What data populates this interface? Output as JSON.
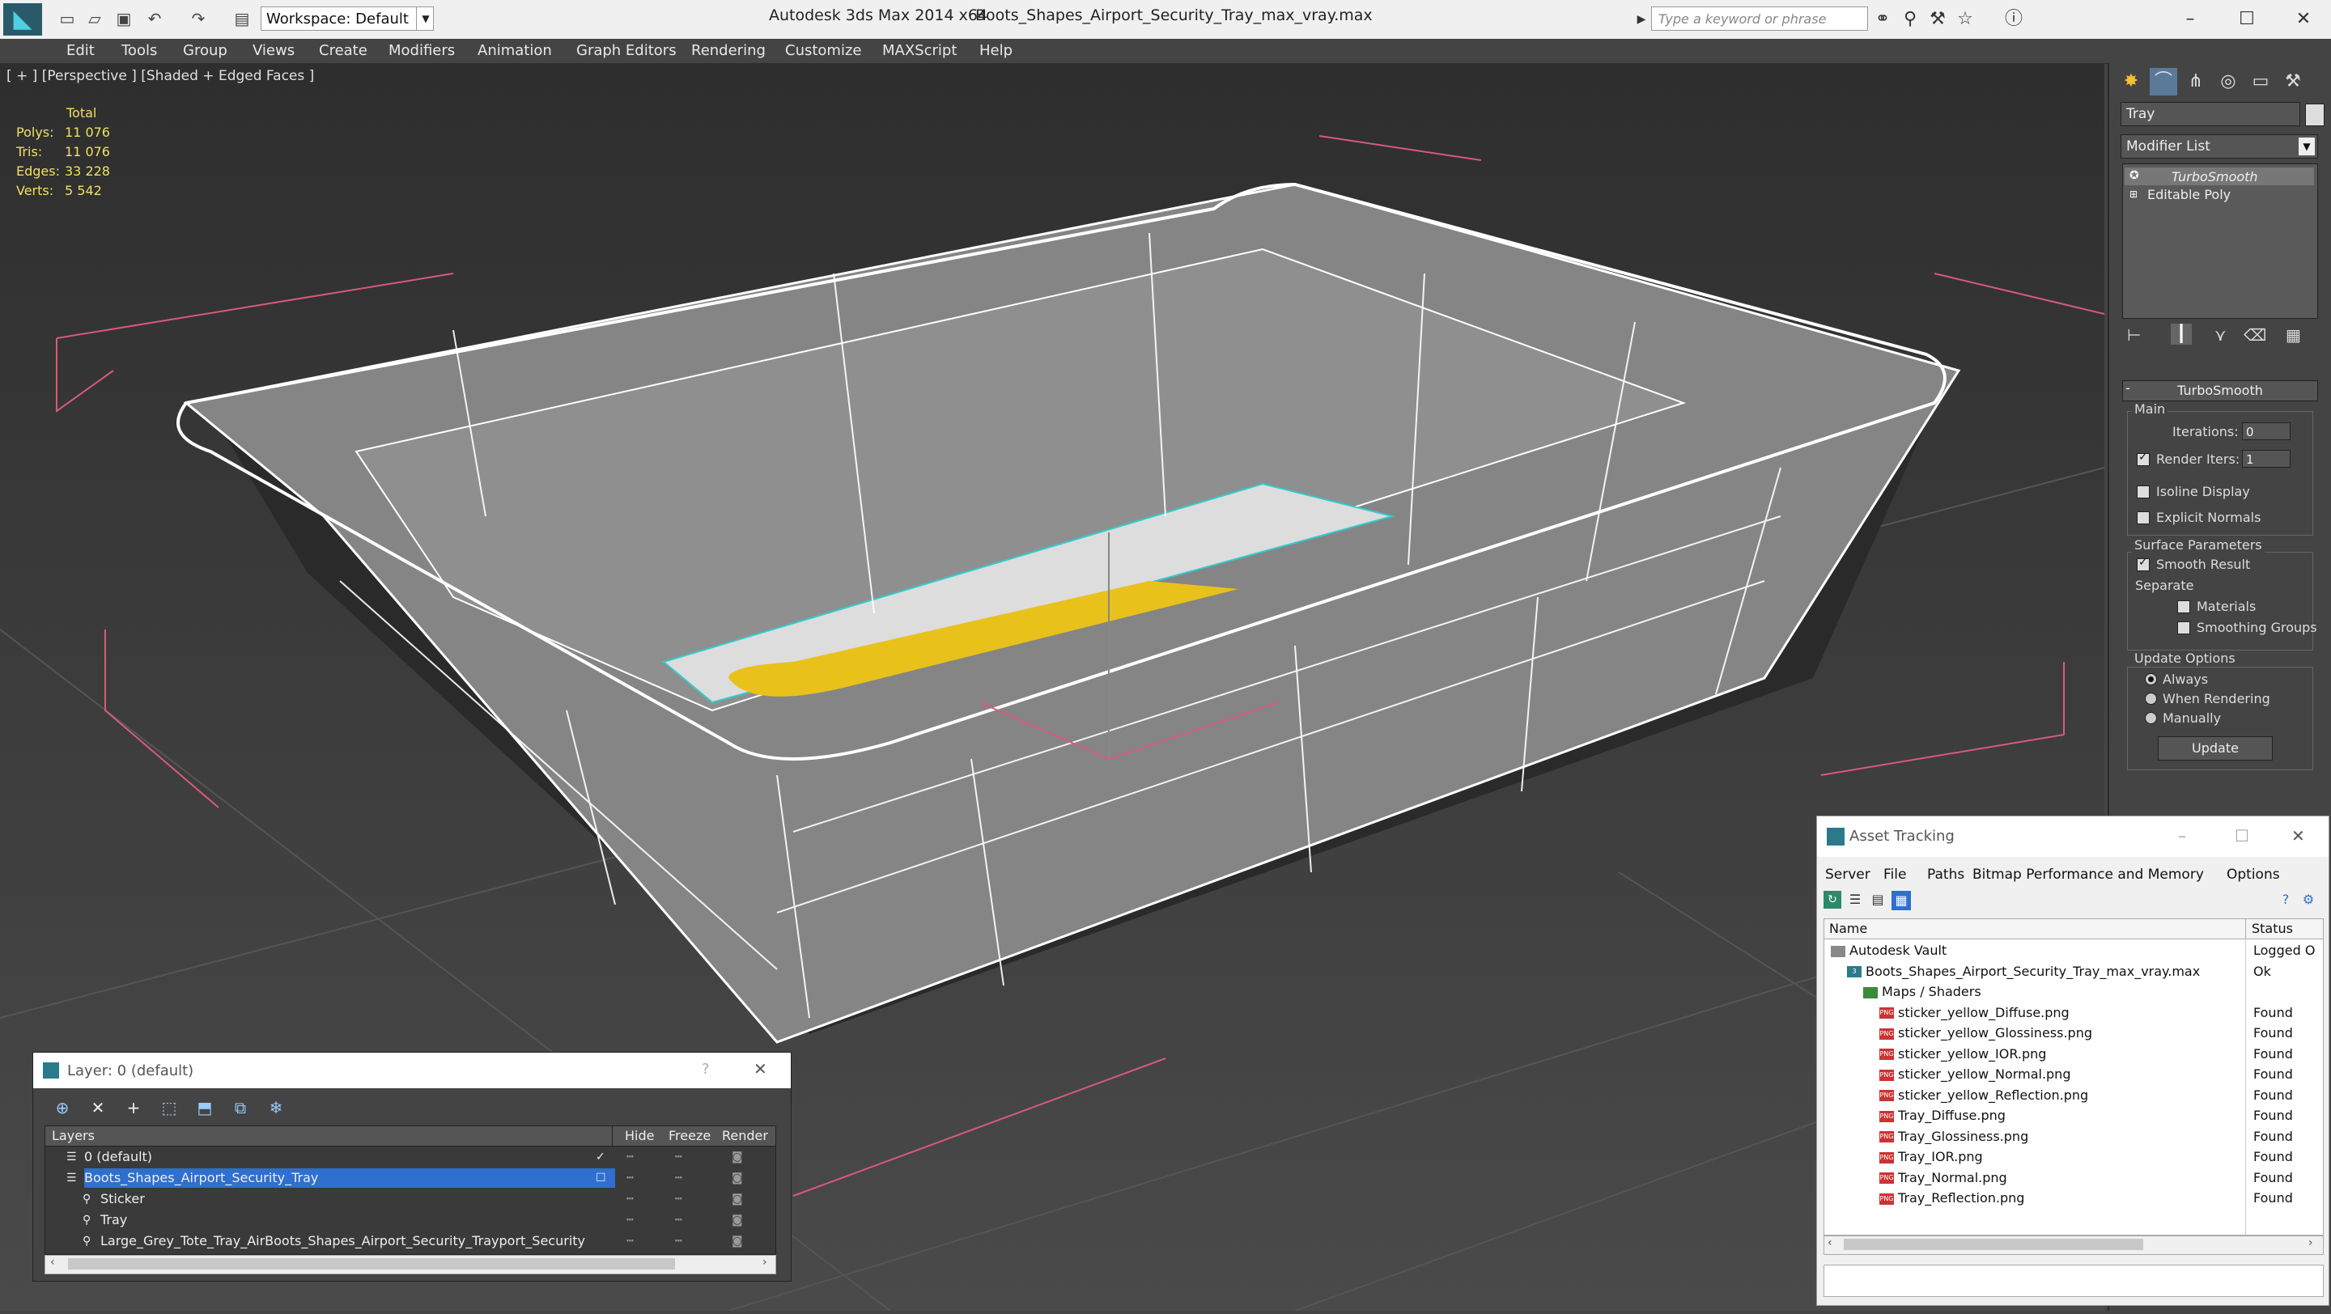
{
  "titlebar": {
    "app_title": "Autodesk 3ds Max  2014 x64",
    "file_name": "Boots_Shapes_Airport_Security_Tray_max_vray.max",
    "workspace_label": "Workspace: Default",
    "search_placeholder": "Type a keyword or phrase"
  },
  "menu": [
    "Edit",
    "Tools",
    "Group",
    "Views",
    "Create",
    "Modifiers",
    "Animation",
    "Graph Editors",
    "Rendering",
    "Customize",
    "MAXScript",
    "Help"
  ],
  "viewport": {
    "label": "[ + ] [Perspective ] [Shaded + Edged Faces ]",
    "stats_header": "Total",
    "stats": [
      {
        "label": "Polys:",
        "value": "11 076"
      },
      {
        "label": "Tris:",
        "value": "11 076"
      },
      {
        "label": "Edges:",
        "value": "33 228"
      },
      {
        "label": "Verts:",
        "value": "5 542"
      }
    ],
    "colors": {
      "mesh": "#8a8a8a",
      "wire": "#ffffff",
      "sticker": "#e8c21a",
      "grid": "#d85a7a"
    }
  },
  "command_panel": {
    "object_name": "Tray",
    "modifier_list": "Modifier List",
    "stack": [
      "TurboSmooth",
      "Editable Poly"
    ],
    "rollout_title": "TurboSmooth",
    "main_group": "Main",
    "iterations_label": "Iterations:",
    "iterations_value": "0",
    "render_iters_label": "Render Iters:",
    "render_iters_value": "1",
    "isoline_label": "Isoline Display",
    "explicit_normals_label": "Explicit Normals",
    "surface_group": "Surface Parameters",
    "smooth_result_label": "Smooth Result",
    "separate_label": "Separate",
    "materials_label": "Materials",
    "smoothing_groups_label": "Smoothing Groups",
    "update_group": "Update Options",
    "always_label": "Always",
    "when_rendering_label": "When Rendering",
    "manually_label": "Manually",
    "update_button": "Update"
  },
  "asset_tracking": {
    "title": "Asset Tracking",
    "menu": [
      "Server",
      "File",
      "Paths",
      "Bitmap Performance and Memory",
      "Options"
    ],
    "col_name": "Name",
    "col_status": "Status",
    "rows": [
      {
        "name": "Autodesk Vault",
        "status": "Logged O",
        "indent": 0,
        "kind": "vault"
      },
      {
        "name": "Boots_Shapes_Airport_Security_Tray_max_vray.max",
        "status": "Ok",
        "indent": 1,
        "kind": "max"
      },
      {
        "name": "Maps / Shaders",
        "status": "",
        "indent": 2,
        "kind": "maps"
      },
      {
        "name": "sticker_yellow_Diffuse.png",
        "status": "Found",
        "indent": 3,
        "kind": "png"
      },
      {
        "name": "sticker_yellow_Glossiness.png",
        "status": "Found",
        "indent": 3,
        "kind": "png"
      },
      {
        "name": "sticker_yellow_IOR.png",
        "status": "Found",
        "indent": 3,
        "kind": "png"
      },
      {
        "name": "sticker_yellow_Normal.png",
        "status": "Found",
        "indent": 3,
        "kind": "png"
      },
      {
        "name": "sticker_yellow_Reflection.png",
        "status": "Found",
        "indent": 3,
        "kind": "png"
      },
      {
        "name": "Tray_Diffuse.png",
        "status": "Found",
        "indent": 3,
        "kind": "png"
      },
      {
        "name": "Tray_Glossiness.png",
        "status": "Found",
        "indent": 3,
        "kind": "png"
      },
      {
        "name": "Tray_IOR.png",
        "status": "Found",
        "indent": 3,
        "kind": "png"
      },
      {
        "name": "Tray_Normal.png",
        "status": "Found",
        "indent": 3,
        "kind": "png"
      },
      {
        "name": "Tray_Reflection.png",
        "status": "Found",
        "indent": 3,
        "kind": "png"
      }
    ]
  },
  "layer_manager": {
    "title": "Layer: 0 (default)",
    "help": "?",
    "col_layers": "Layers",
    "col_hide": "Hide",
    "col_freeze": "Freeze",
    "col_render": "Render",
    "rows": [
      {
        "name": "0 (default)",
        "selected": false,
        "indent": 0
      },
      {
        "name": "Boots_Shapes_Airport_Security_Tray",
        "selected": true,
        "indent": 0
      },
      {
        "name": "Sticker",
        "selected": false,
        "indent": 1
      },
      {
        "name": "Tray",
        "selected": false,
        "indent": 1
      },
      {
        "name": "Large_Grey_Tote_Tray_AirBoots_Shapes_Airport_Security_Trayport_Security",
        "selected": false,
        "indent": 1
      }
    ]
  }
}
